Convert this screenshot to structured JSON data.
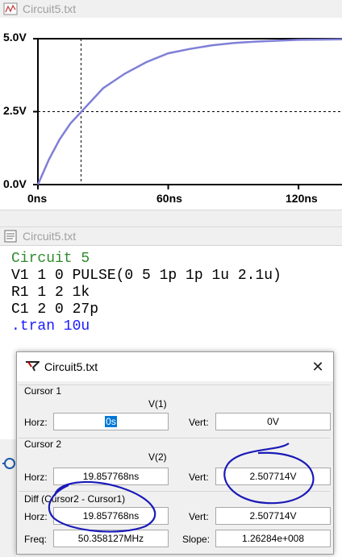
{
  "plot_window": {
    "title": "Circuit5.txt"
  },
  "netlist_window": {
    "title": "Circuit5.txt",
    "lines": [
      {
        "text": "Circuit 5",
        "color": "#2e8b2e"
      },
      {
        "text": "V1 1 0 PULSE(0 5 1p 1p 1u 2.1u)",
        "color": "#000000"
      },
      {
        "text": "R1 1 2 1k",
        "color": "#000000"
      },
      {
        "text": "C1 2 0 27p",
        "color": "#000000"
      },
      {
        "text": ".tran 10u",
        "color": "#1a1aff"
      }
    ]
  },
  "chart_data": {
    "type": "line",
    "x_unit": "ns",
    "xlim": [
      0,
      140
    ],
    "ylim": [
      0,
      5
    ],
    "x_ticks": [
      "0ns",
      "60ns",
      "120ns"
    ],
    "y_ticks": [
      "0.0V",
      "2.5V",
      "5.0V"
    ],
    "grid": "dashed at 2.5V and at cursor x",
    "series": [
      {
        "x": [
          0,
          5,
          10,
          15,
          20,
          30,
          40,
          50,
          60,
          70,
          80,
          90,
          100,
          110,
          120,
          130,
          140
        ],
        "y": [
          0,
          0.85,
          1.55,
          2.1,
          2.5,
          3.3,
          3.8,
          4.2,
          4.5,
          4.65,
          4.77,
          4.85,
          4.9,
          4.93,
          4.96,
          4.97,
          4.98
        ],
        "color": "#7f7fd6"
      }
    ],
    "cursor_x": 19.857768,
    "line_color": "#7f7fd6"
  },
  "dialog": {
    "title": "Circuit5.txt",
    "close_label": "✕",
    "cursor1": {
      "label": "Cursor 1",
      "trace": "V(1)",
      "horz_label": "Horz:",
      "horz": "0s",
      "vert_label": "Vert:",
      "vert": "0V"
    },
    "cursor2": {
      "label": "Cursor 2",
      "trace": "V(2)",
      "horz_label": "Horz:",
      "horz": "19.857768ns",
      "vert_label": "Vert:",
      "vert": "2.507714V"
    },
    "diff": {
      "label": "Diff (Cursor2 - Cursor1)",
      "horz_label": "Horz:",
      "horz": "19.857768ns",
      "vert_label": "Vert:",
      "vert": "2.507714V",
      "freq_label": "Freq:",
      "freq": "50.358127MHz",
      "slope_label": "Slope:",
      "slope": "1.26284e+008"
    }
  },
  "annotation_color": "#1a1ab8"
}
